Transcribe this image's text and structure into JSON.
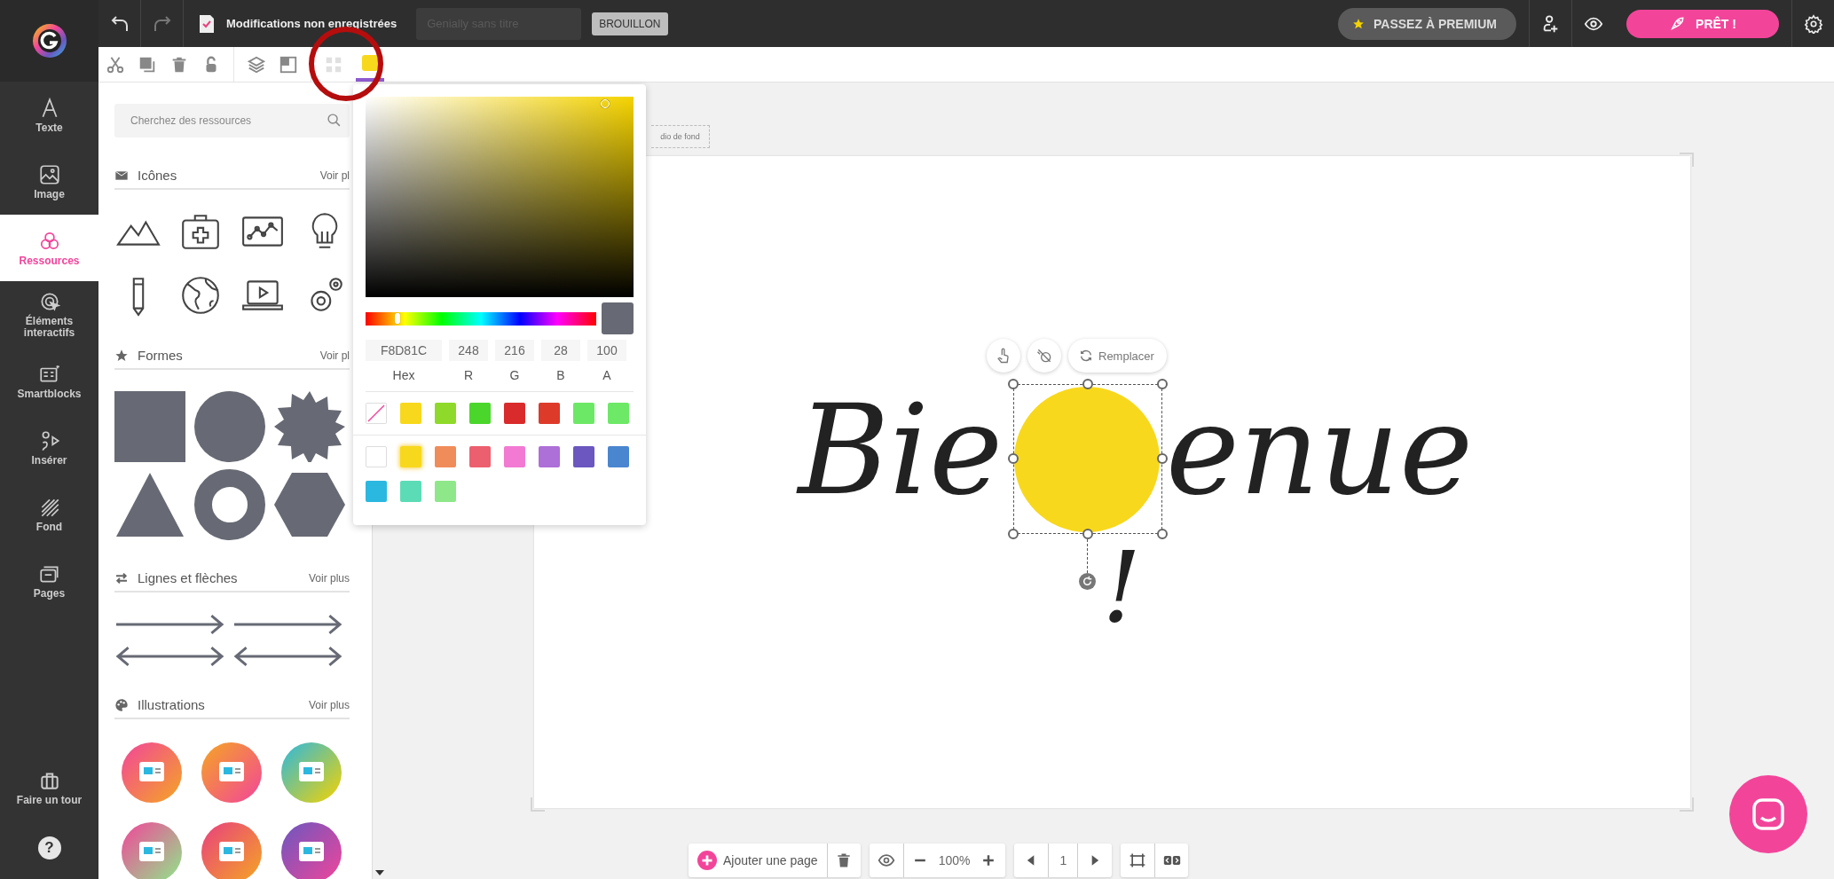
{
  "topbar": {
    "save_status": "Modifications non enregistrées",
    "title_field": {
      "placeholder": "Genially sans titre"
    },
    "status_badge": "BROUILLON",
    "premium_button": "PASSEZ À PREMIUM",
    "ready_button": "PRÊT !"
  },
  "toolbar": {
    "color_swatch": {
      "color": "#f8d81c",
      "selected": true
    }
  },
  "sidebar": {
    "items": [
      {
        "label": "Texte",
        "selected": false
      },
      {
        "label": "Image",
        "selected": false
      },
      {
        "label": "Ressources",
        "selected": true
      },
      {
        "label": "Éléments interactifs",
        "selected": false
      },
      {
        "label": "Smartblocks",
        "selected": false
      },
      {
        "label": "Insérer",
        "selected": false
      },
      {
        "label": "Fond",
        "selected": false
      },
      {
        "label": "Pages",
        "selected": false
      }
    ],
    "tour": "Faire un tour",
    "help": "?"
  },
  "resources": {
    "search": {
      "placeholder": "Cherchez des ressources"
    },
    "sections": [
      {
        "title": "Icônes",
        "more": "Voir pl"
      },
      {
        "title": "Formes",
        "more": "Voir pl"
      },
      {
        "title": "Lignes et flèches",
        "more": "Voir plus"
      },
      {
        "title": "Illustrations",
        "more": "Voir plus"
      }
    ]
  },
  "color_picker": {
    "hue": {
      "level": 0.14
    },
    "fields": [
      {
        "value": "F8D81C",
        "label": "Hex"
      },
      {
        "value": "248",
        "label": "R"
      },
      {
        "value": "216",
        "label": "G"
      },
      {
        "value": "28",
        "label": "B"
      },
      {
        "value": "100",
        "label": "A"
      }
    ],
    "recent": [
      {
        "kind": "transparent"
      },
      {
        "kind": "color",
        "color": "#f8d81c"
      },
      {
        "kind": "color",
        "color": "#8fd92a"
      },
      {
        "kind": "color",
        "color": "#4bd62c"
      },
      {
        "kind": "color",
        "color": "#d92b2b"
      },
      {
        "kind": "color",
        "color": "#dd3a2a"
      },
      {
        "kind": "color",
        "color": "#6de866"
      },
      {
        "kind": "color",
        "color": "#6de867"
      }
    ],
    "palette": [
      {
        "color": "#ffffff",
        "selected": false
      },
      {
        "color": "#f8d81c",
        "selected": true
      },
      {
        "color": "#f08c5a",
        "selected": false
      },
      {
        "color": "#ec5f6e",
        "selected": false
      },
      {
        "color": "#f27ad2",
        "selected": false
      },
      {
        "color": "#ad6fd8",
        "selected": false
      },
      {
        "color": "#6b57bf",
        "selected": false
      },
      {
        "color": "#4a86cf",
        "selected": false
      },
      {
        "color": "#2bb8e0",
        "selected": false
      },
      {
        "color": "#5cdcb6",
        "selected": false
      },
      {
        "color": "#8ee88a",
        "selected": false
      }
    ]
  },
  "canvas": {
    "audio_label": "dio de fond",
    "title_parts": [
      "Bie",
      "enue"
    ],
    "exclamation": "!",
    "shape": {
      "color": "#f8d81c",
      "selected": true
    },
    "replace_button": "Remplacer"
  },
  "bottom_bar": {
    "add_page": "Ajouter une page",
    "zoom": "100%",
    "page": "1"
  }
}
